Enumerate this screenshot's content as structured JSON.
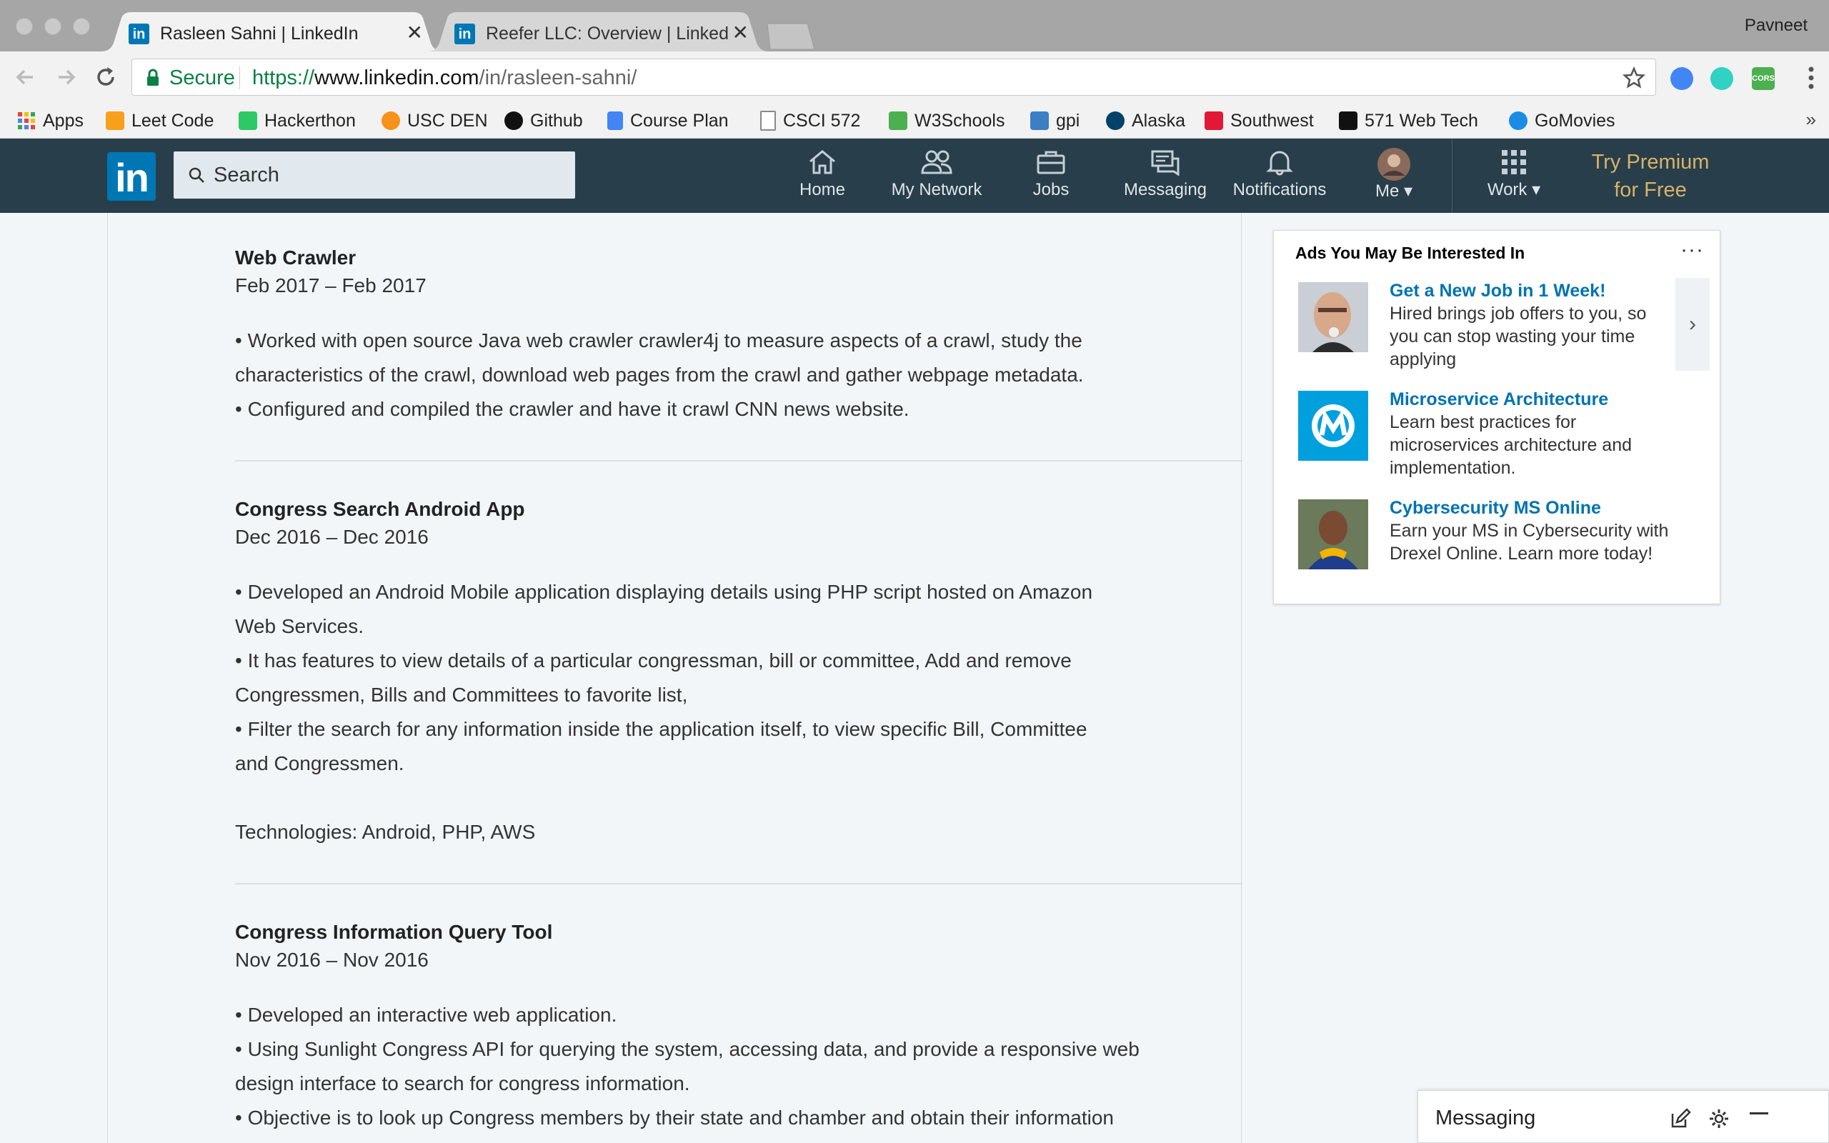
{
  "browser": {
    "user": "Pavneet",
    "tabs": [
      {
        "title": "Rasleen Sahni | LinkedIn",
        "favicon": "in"
      },
      {
        "title": "Reefer LLC: Overview | LinkedIn",
        "favicon": "in"
      }
    ],
    "address": {
      "security_label": "Secure",
      "scheme": "https://",
      "host": "www.linkedin.com",
      "path": "/in/rasleen-sahni/"
    },
    "bookmarks": [
      {
        "label": "Apps",
        "icon": "apps-grid-icon",
        "color": "#e94235"
      },
      {
        "label": "Leet Code",
        "icon": "leetcode-icon",
        "color": "#f89f1b"
      },
      {
        "label": "Hackerthon",
        "icon": "hackerrank-icon",
        "color": "#2ec866"
      },
      {
        "label": "USC DEN",
        "icon": "bitcoin-icon",
        "color": "#f7931a"
      },
      {
        "label": "Github",
        "icon": "github-icon",
        "color": "#111111"
      },
      {
        "label": "Course Plan",
        "icon": "doc-icon",
        "color": "#4285f4"
      },
      {
        "label": "CSCI 572",
        "icon": "page-icon",
        "color": "#888888"
      },
      {
        "label": "W3Schools",
        "icon": "w3schools-icon",
        "color": "#4caf50"
      },
      {
        "label": "gpi",
        "icon": "gpi-icon",
        "color": "#3b7fc4"
      },
      {
        "label": "Alaska",
        "icon": "alaska-icon",
        "color": "#01426a"
      },
      {
        "label": "Southwest",
        "icon": "southwest-icon",
        "color": "#e21836"
      },
      {
        "label": "571 Web Tech",
        "icon": "usc-icon",
        "color": "#111111"
      },
      {
        "label": "GoMovies",
        "icon": "gomovies-icon",
        "color": "#1a8ce5"
      }
    ],
    "bookmarks_more": "»"
  },
  "linkedin": {
    "logo": "in",
    "search_placeholder": "Search",
    "nav": [
      {
        "label": "Home",
        "icon": "home-icon"
      },
      {
        "label": "My Network",
        "icon": "network-icon"
      },
      {
        "label": "Jobs",
        "icon": "briefcase-icon"
      },
      {
        "label": "Messaging",
        "icon": "messaging-icon"
      },
      {
        "label": "Notifications",
        "icon": "bell-icon"
      },
      {
        "label": "Me ▾",
        "icon": "avatar"
      },
      {
        "label": "Work ▾",
        "icon": "grid-icon"
      }
    ],
    "premium_line1": "Try Premium",
    "premium_line2": "for Free",
    "header_color": "#283e4a",
    "brand_color": "#0077b5",
    "premium_color": "#d8b26a"
  },
  "projects": [
    {
      "title": "Web Crawler",
      "dates": "Feb 2017 – Feb 2017",
      "lines": [
        "• Worked with open source Java web crawler crawler4j to measure aspects of a crawl, study the",
        "characteristics of the crawl, download web pages from the crawl and gather webpage metadata.",
        "• Configured and compiled the crawler and have it crawl CNN news website."
      ]
    },
    {
      "title": "Congress Search Android App",
      "dates": "Dec 2016 – Dec 2016",
      "lines": [
        "• Developed an Android Mobile application displaying details using PHP script hosted on Amazon",
        "Web Services.",
        "• It has features to view details of a particular congressman, bill or committee, Add and remove",
        "Congressmen, Bills and Committees to favorite list,",
        "• Filter the search for any information inside the application itself, to view specific Bill, Committee",
        "and Congressmen.",
        "",
        "Technologies: Android, PHP, AWS"
      ]
    },
    {
      "title": "Congress Information Query Tool",
      "dates": "Nov 2016 – Nov 2016",
      "lines": [
        "• Developed an interactive web application.",
        "• Using Sunlight Congress API for querying the system, accessing data, and provide a responsive web",
        "design interface to search for congress information.",
        "• Objective is to look up Congress members by their state and chamber and obtain their information"
      ]
    }
  ],
  "ads": {
    "title": "Ads You May Be Interested In",
    "more": "···",
    "next": "›",
    "items": [
      {
        "headline": "Get a New Job in 1 Week!",
        "body": "Hired brings job offers to you, so you can stop wasting your time applying",
        "image": "hired-ad-photo"
      },
      {
        "headline": "Microservice Architecture",
        "body": "Learn best practices for microservices architecture and implementation.",
        "image": "mulesoft-logo"
      },
      {
        "headline": "Cybersecurity MS Online",
        "body": "Earn your MS in Cybersecurity with Drexel Online. Learn more today!",
        "image": "drexel-ad-photo"
      }
    ]
  },
  "messaging_dock": {
    "title": "Messaging"
  }
}
